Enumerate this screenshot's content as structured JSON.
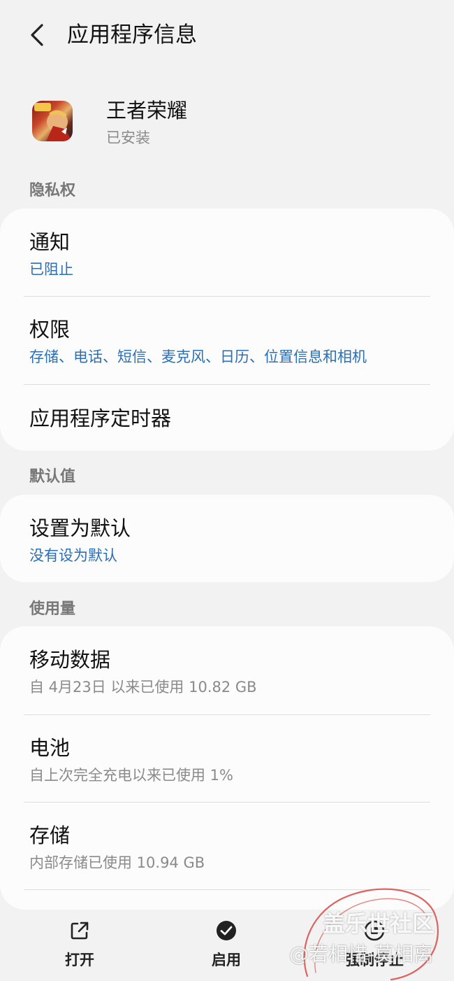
{
  "header": {
    "title": "应用程序信息"
  },
  "app": {
    "name": "王者荣耀",
    "status": "已安装",
    "icon": "app-icon"
  },
  "sections": {
    "privacy": "隐私权",
    "defaults": "默认值",
    "usage": "使用量"
  },
  "privacy_items": {
    "notifications": {
      "title": "通知",
      "subtitle": "已阻止"
    },
    "permissions": {
      "title": "权限",
      "subtitle": "存储、电话、短信、麦克风、日历、位置信息和相机"
    },
    "timer": {
      "title": "应用程序定时器"
    }
  },
  "default_items": {
    "set_default": {
      "title": "设置为默认",
      "subtitle": "没有设为默认"
    }
  },
  "usage_items": {
    "mobile_data": {
      "title": "移动数据",
      "subtitle": "自 4月23日 以来已使用 10.82 GB"
    },
    "battery": {
      "title": "电池",
      "subtitle": "自上次完全充电以来已使用 1%"
    },
    "storage": {
      "title": "存储",
      "subtitle": "内部存储已使用 10.94 GB"
    }
  },
  "bottom_bar": {
    "open": {
      "label": "打开",
      "icon": "open-external-icon"
    },
    "enable": {
      "label": "启用",
      "icon": "check-circle-icon"
    },
    "force_stop": {
      "label": "强制停止",
      "icon": "stop-icon"
    }
  },
  "watermark": {
    "site": "盖乐世社区",
    "user": "@若相惜-莫相离",
    "color": "#d9534f"
  },
  "colors": {
    "accent_blue": "#2a6fb8",
    "background": "#f2f2f2",
    "card": "#fcfcfc"
  }
}
